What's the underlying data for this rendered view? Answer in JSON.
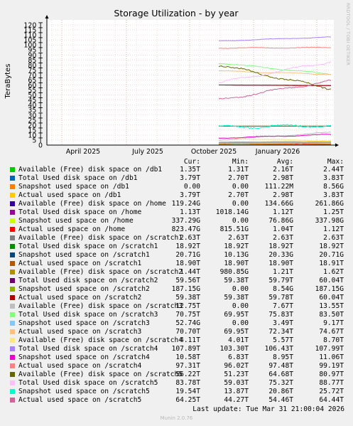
{
  "chart_data": {
    "type": "line",
    "title": "Storage Utilization - by year",
    "ylabel": "TeraBytes",
    "ylim": [
      0,
      125
    ],
    "yticks": [
      "0",
      "5 T",
      "10 T",
      "15 T",
      "20 T",
      "25 T",
      "30 T",
      "35 T",
      "40 T",
      "45 T",
      "50 T",
      "55 T",
      "60 T",
      "65 T",
      "70 T",
      "75 T",
      "80 T",
      "85 T",
      "90 T",
      "95 T",
      "100 T",
      "105 T",
      "110 T",
      "115 T",
      "120 T"
    ],
    "xticks": [
      "April 2025",
      "July 2025",
      "October 2025",
      "January 2026"
    ],
    "grid": true,
    "series": [
      {
        "name": "Available (Free) disk space on /db1",
        "color": "#00cc00",
        "cur": "1.35T",
        "min": "1.31T",
        "avg": "2.16T",
        "max": "2.44T",
        "start": 1.35,
        "end": 1.35,
        "noise": 0.05
      },
      {
        "name": "Total Used disk space on /db1",
        "color": "#0066b3",
        "cur": "3.79T",
        "min": "2.70T",
        "avg": "2.98T",
        "max": "3.83T",
        "start": 2.8,
        "end": 3.79,
        "noise": 0.05
      },
      {
        "name": "Snapshot used space on /db1",
        "color": "#ff8000",
        "cur": "0.00",
        "min": "0.00",
        "avg": "111.22M",
        "max": "8.56G",
        "start": 0.0,
        "end": 0.0,
        "noise": 0.0
      },
      {
        "name": "Actual used space on /db1",
        "color": "#ffcc00",
        "cur": "3.79T",
        "min": "2.70T",
        "avg": "2.98T",
        "max": "3.83T",
        "start": 2.8,
        "end": 3.79,
        "noise": 0.05
      },
      {
        "name": "Available (Free) disk space on /home",
        "color": "#330099",
        "cur": "119.24G",
        "min": "0.00",
        "avg": "134.66G",
        "max": "261.86G",
        "start": 0.2,
        "end": 0.12,
        "noise": 0.05
      },
      {
        "name": "Total Used disk space on /home",
        "color": "#990099",
        "cur": "1.13T",
        "min": "1018.14G",
        "avg": "1.12T",
        "max": "1.25T",
        "start": 1.1,
        "end": 1.13,
        "noise": 0.05
      },
      {
        "name": "Snapshot used space on /home",
        "color": "#ccff00",
        "cur": "337.29G",
        "min": "0.00",
        "avg": "76.86G",
        "max": "337.98G",
        "start": 0.05,
        "end": 0.34,
        "noise": 0.02
      },
      {
        "name": "Actual used space on /home",
        "color": "#ff0000",
        "cur": "823.47G",
        "min": "815.51G",
        "avg": "1.04T",
        "max": "1.12T",
        "start": 1.1,
        "end": 0.82,
        "noise": 0.05
      },
      {
        "name": "Available (Free) disk space on /scratch1",
        "color": "#808080",
        "cur": "2.63T",
        "min": "2.63T",
        "avg": "2.63T",
        "max": "2.63T",
        "start": 2.63,
        "end": 2.63,
        "noise": 0.0
      },
      {
        "name": "Total Used disk space on /scratch1",
        "color": "#008f00",
        "cur": "18.92T",
        "min": "18.92T",
        "avg": "18.92T",
        "max": "18.92T",
        "start": 18.92,
        "end": 18.92,
        "noise": 0.0
      },
      {
        "name": "Snapshot used space on /scratch1",
        "color": "#00487d",
        "cur": "20.71G",
        "min": "10.13G",
        "avg": "20.33G",
        "max": "20.71G",
        "start": 0.02,
        "end": 0.02,
        "noise": 0.0
      },
      {
        "name": "Actual used space on /scratch1",
        "color": "#b35a00",
        "cur": "18.90T",
        "min": "18.90T",
        "avg": "18.90T",
        "max": "18.91T",
        "start": 18.9,
        "end": 18.9,
        "noise": 0.0
      },
      {
        "name": "Available (Free) disk space on /scratch2",
        "color": "#b38f00",
        "cur": "1.44T",
        "min": "980.85G",
        "avg": "1.21T",
        "max": "1.62T",
        "start": 1.2,
        "end": 1.44,
        "noise": 0.1
      },
      {
        "name": "Total Used disk space on /scratch2",
        "color": "#6b006b",
        "cur": "59.56T",
        "min": "59.38T",
        "avg": "59.79T",
        "max": "60.04T",
        "start": 60.0,
        "end": 59.56,
        "noise": 0.05
      },
      {
        "name": "Snapshot used space on /scratch2",
        "color": "#8fb300",
        "cur": "187.15G",
        "min": "0.00",
        "avg": "8.54G",
        "max": "187.15G",
        "start": 0.0,
        "end": 0.19,
        "noise": 0.0
      },
      {
        "name": "Actual used space on /scratch2",
        "color": "#b30000",
        "cur": "59.38T",
        "min": "59.38T",
        "avg": "59.78T",
        "max": "60.04T",
        "start": 60.0,
        "end": 59.38,
        "noise": 0.05
      },
      {
        "name": "Available (Free) disk space on /scratch3",
        "color": "#bebebe",
        "cur": "12.75T",
        "min": "0.00",
        "avg": "7.67T",
        "max": "13.55T",
        "start": 5.0,
        "end": 12.75,
        "noise": 0.4
      },
      {
        "name": "Total Used disk space on /scratch3",
        "color": "#80ff80",
        "cur": "70.75T",
        "min": "69.95T",
        "avg": "75.83T",
        "max": "83.50T",
        "start": 82.0,
        "end": 70.75,
        "noise": 0.5
      },
      {
        "name": "Snapshot used space on /scratch3",
        "color": "#80c9ff",
        "cur": "52.74G",
        "min": "0.00",
        "avg": "3.49T",
        "max": "9.17T",
        "start": 0.5,
        "end": 0.05,
        "noise": 0.3
      },
      {
        "name": "Actual used space on /scratch3",
        "color": "#ffc080",
        "cur": "70.70T",
        "min": "69.95T",
        "avg": "72.34T",
        "max": "74.67T",
        "start": 74.0,
        "end": 70.7,
        "noise": 0.4
      },
      {
        "name": "Available (Free) disk space on /scratch4",
        "color": "#ffe680",
        "cur": "4.11T",
        "min": "4.01T",
        "avg": "5.57T",
        "max": "8.70T",
        "start": 7.0,
        "end": 4.11,
        "noise": 0.3
      },
      {
        "name": "Total Used disk space on /scratch4",
        "color": "#aa80ff",
        "cur": "107.89T",
        "min": "103.30T",
        "avg": "106.43T",
        "max": "107.99T",
        "start": 104.0,
        "end": 107.89,
        "noise": 0.3
      },
      {
        "name": "Snapshot used space on /scratch4",
        "color": "#ee00cc",
        "cur": "10.58T",
        "min": "6.83T",
        "avg": "8.95T",
        "max": "11.06T",
        "start": 7.0,
        "end": 10.58,
        "noise": 0.4
      },
      {
        "name": "Actual used space on /scratch4",
        "color": "#ff8080",
        "cur": "97.31T",
        "min": "96.02T",
        "avg": "97.48T",
        "max": "99.19T",
        "start": 97.0,
        "end": 97.31,
        "noise": 0.4
      },
      {
        "name": "Available (Free) disk space on /scratch5",
        "color": "#666600",
        "cur": "56.22T",
        "min": "51.23T",
        "avg": "64.68T",
        "max": "80.97T",
        "start": 80.0,
        "end": 56.22,
        "noise": 1.2
      },
      {
        "name": "Total Used disk space on /scratch5",
        "color": "#ffbfff",
        "cur": "83.78T",
        "min": "59.03T",
        "avg": "75.32T",
        "max": "88.77T",
        "start": 62.0,
        "end": 83.78,
        "noise": 1.2
      },
      {
        "name": "Snapshot used space on /scratch5",
        "color": "#00ffcc",
        "cur": "19.54T",
        "min": "13.87T",
        "avg": "20.86T",
        "max": "25.72T",
        "start": 18.0,
        "end": 19.54,
        "noise": 1.5
      },
      {
        "name": "Actual used space on /scratch5",
        "color": "#cc6699",
        "cur": "64.25T",
        "min": "44.27T",
        "avg": "54.46T",
        "max": "64.44T",
        "start": 45.0,
        "end": 64.25,
        "noise": 1.0
      }
    ]
  },
  "legend_headers": {
    "cur": "Cur:",
    "min": "Min:",
    "avg": "Avg:",
    "max": "Max:"
  },
  "last_update": "Last update: Tue Mar 31 21:00:04 2026",
  "munin_version": "Munin 2.0.76",
  "side_text": "RRDTOOL / TOBI OETIKER"
}
